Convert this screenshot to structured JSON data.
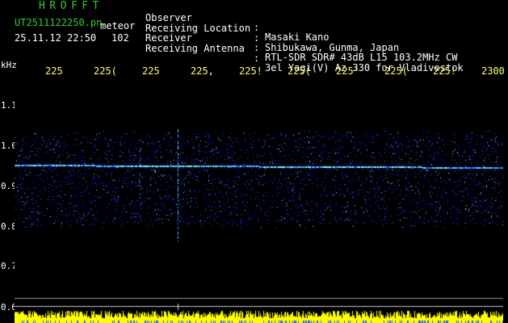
{
  "header": {
    "title": "HROFFT",
    "filename": "UT2511122250.pn",
    "mode": "meteor",
    "datetime": "25.11.12 22:50",
    "count": "102"
  },
  "metadata": [
    {
      "key": "Observer",
      "value": "Masaki Kano"
    },
    {
      "key": "Receiving Location",
      "value": "Shibukawa, Gunma, Japan"
    },
    {
      "key": "Receiver",
      "value": "RTL-SDR SDR# 43dB L15 103.2MHz CW"
    },
    {
      "key": "Receiving Antenna",
      "value": "3el Yagi(V) Az 330 for Vladivostok"
    }
  ],
  "axis": {
    "unit": "kHz",
    "x_ticks": [
      "225",
      "225(",
      "225",
      "225,",
      "225!",
      "225(",
      "225'",
      "225(",
      "225!",
      "2300"
    ],
    "y_ticks": [
      "1.1",
      "1.0",
      "0.9",
      "0.8",
      "0.7",
      "0.6"
    ]
  },
  "colors": {
    "background": "#000000",
    "title": "#33cc33",
    "ticks": "#ffff66",
    "signal_low": "#0000aa",
    "signal_mid": "#3355ff",
    "signal_high": "#66ffff",
    "level_bar": "#ffff00"
  }
}
